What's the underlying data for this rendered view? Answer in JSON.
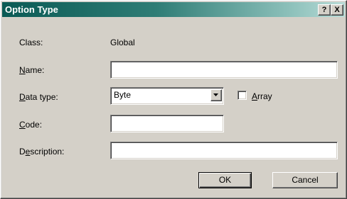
{
  "window": {
    "title": "Option Type",
    "help_button": "?",
    "close_button": "X"
  },
  "form": {
    "class_label": "Class:",
    "class_value": "Global",
    "name_label": {
      "accel": "N",
      "rest": "ame:"
    },
    "name_value": "",
    "data_type_label": {
      "accel": "D",
      "rest": "ata type:"
    },
    "data_type_value": "Byte",
    "array_label": {
      "accel": "A",
      "rest": "rray"
    },
    "array_checked": false,
    "code_label": {
      "accel": "C",
      "rest": "ode:"
    },
    "code_value": "",
    "description_label": {
      "pre": "D",
      "accel": "e",
      "rest": "scription:"
    },
    "description_value": ""
  },
  "buttons": {
    "ok": "OK",
    "cancel": "Cancel"
  }
}
